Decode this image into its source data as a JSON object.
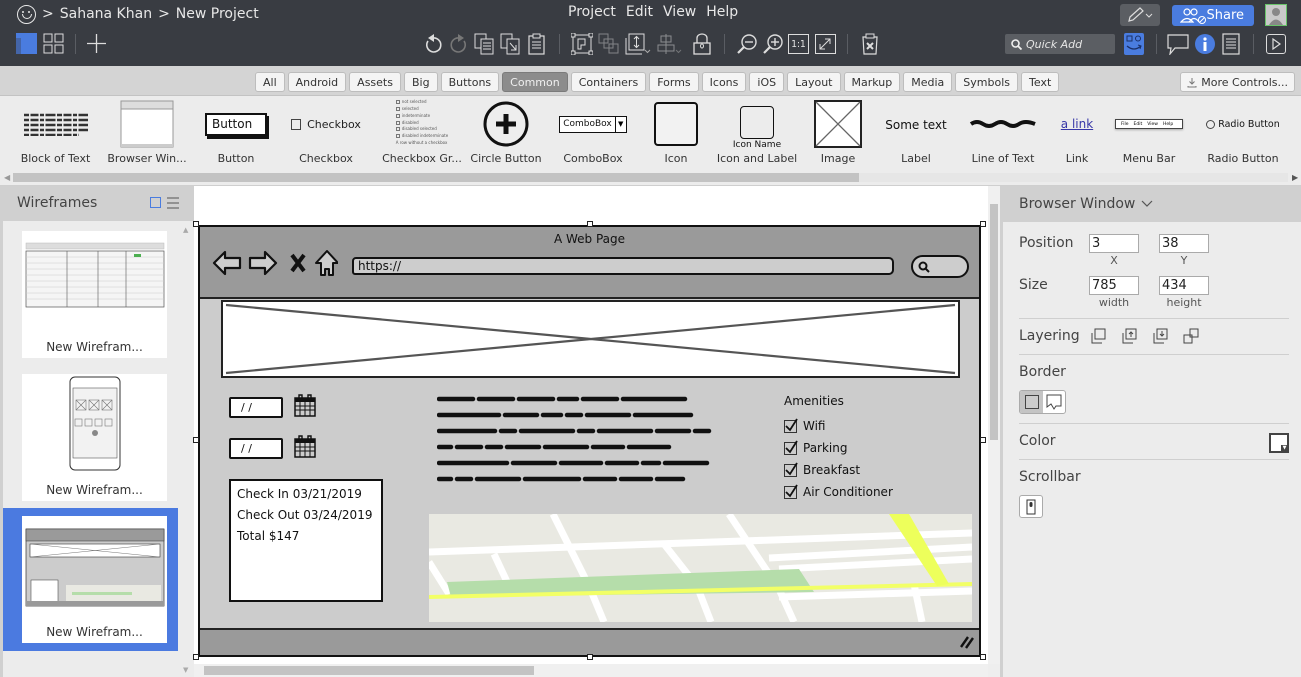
{
  "app": {
    "breadcrumb": [
      "Sahana Khan",
      "New Project"
    ],
    "breadcrumb_separator": ">",
    "menu": [
      "Project",
      "Edit",
      "View",
      "Help"
    ],
    "share_label": "Share",
    "quick_add_placeholder": "Quick Add",
    "accent_color": "#4a7cdf"
  },
  "toolbar": {
    "left_icons": [
      "single-view-icon",
      "grid-view-icon",
      "add-icon"
    ],
    "center_icons": [
      "undo-icon",
      "redo-icon",
      "duplicate-icon",
      "copy-to-icon",
      "paste-icon",
      "group-icon",
      "ungroup-icon",
      "arrange-icon",
      "align-icon",
      "lock-icon",
      "zoom-out-icon",
      "zoom-in-icon",
      "actual-size-icon",
      "fit-icon",
      "delete-icon"
    ],
    "actual_size_label": "1:1",
    "right_icons": [
      "quick-add-assets-icon",
      "comment-icon",
      "info-icon",
      "notes-icon",
      "present-icon"
    ]
  },
  "library": {
    "tabs": [
      "All",
      "Android",
      "Assets",
      "Big",
      "Buttons",
      "Common",
      "Containers",
      "Forms",
      "Icons",
      "iOS",
      "Layout",
      "Markup",
      "Media",
      "Symbols",
      "Text"
    ],
    "active_tab": "Common",
    "more_controls_label": "More Controls...",
    "controls": [
      {
        "label": "Block of Text"
      },
      {
        "label": "Browser Win..."
      },
      {
        "label": "Button",
        "preview_text": "Button"
      },
      {
        "label": "Checkbox",
        "preview_text": "Checkbox"
      },
      {
        "label": "Checkbox Gr...",
        "preview_items": [
          "not selected",
          "selected",
          "indeterminate",
          "disabled",
          "disabled selected",
          "disabled indeterminate",
          "A row without a checkbox"
        ]
      },
      {
        "label": "Circle Button"
      },
      {
        "label": "ComboBox",
        "preview_text": "ComboBox"
      },
      {
        "label": "Icon"
      },
      {
        "label": "Icon and Label",
        "preview_text": "Icon Name"
      },
      {
        "label": "Image"
      },
      {
        "label": "Label",
        "preview_text": "Some text"
      },
      {
        "label": "Line of Text"
      },
      {
        "label": "Link",
        "preview_text": "a link"
      },
      {
        "label": "Menu Bar",
        "preview_items": [
          "File",
          "Edit",
          "View",
          "Help"
        ]
      },
      {
        "label": "Radio Button",
        "preview_text": "Radio Button"
      }
    ]
  },
  "sidebar": {
    "title": "Wireframes",
    "items": [
      {
        "name": "New Wirefram...",
        "selected": false
      },
      {
        "name": "New Wirefram...",
        "selected": false
      },
      {
        "name": "New Wirefram...",
        "selected": true
      }
    ]
  },
  "mockup": {
    "title": "A Web Page",
    "url": "https://",
    "date_placeholder_1": "/ /",
    "date_placeholder_2": "/ /",
    "booking": [
      "Check In 03/21/2019",
      "Check Out 03/24/2019",
      "Total $147"
    ],
    "amenities_title": "Amenities",
    "amenities": [
      {
        "label": "Wifi",
        "checked": true
      },
      {
        "label": "Parking",
        "checked": true
      },
      {
        "label": "Breakfast",
        "checked": true
      },
      {
        "label": "Air Conditioner",
        "checked": true
      }
    ]
  },
  "properties": {
    "title": "Browser Window",
    "position_label": "Position",
    "x": "3",
    "y": "38",
    "x_label": "X",
    "y_label": "Y",
    "size_label": "Size",
    "width": "785",
    "height": "434",
    "width_label": "width",
    "height_label": "height",
    "layering_label": "Layering",
    "border_label": "Border",
    "color_label": "Color",
    "scrollbar_label": "Scrollbar"
  }
}
